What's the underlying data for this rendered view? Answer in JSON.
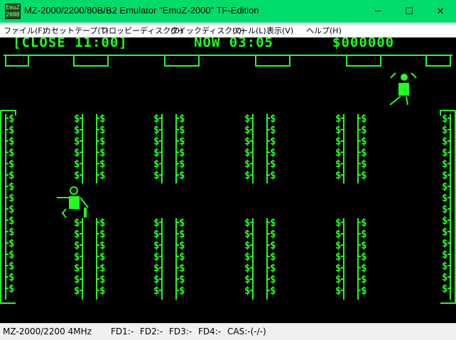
{
  "window": {
    "title": "MZ-2000/2200/80B/B2 Emulator \"EmuZ-2000\" TF-Edition",
    "icon_label_line1": "EmuZ",
    "icon_label_line2": "2000",
    "controls": {
      "minimize": "─",
      "maximize": "☐",
      "close": "✕"
    }
  },
  "menu": [
    {
      "label": "ファイル(F)"
    },
    {
      "label": "カセットテープ(T)"
    },
    {
      "label": "フロッピーディスク(D)"
    },
    {
      "label": "クイックディスク(Q)"
    },
    {
      "label": "ツール(L)"
    },
    {
      "label": "表示(V)"
    },
    {
      "label": "ヘルプ(H)"
    }
  ],
  "game": {
    "close_text": "[CLOSE 11:00]",
    "now_text": "NOW 03:05",
    "money_text": "$000000",
    "cell_symbol": "$",
    "colors": {
      "background": "#000000",
      "foreground": "#22ff22"
    }
  },
  "status": {
    "machine": "MZ-2000/2200 4MHz",
    "fd1": "FD1:-",
    "fd2": "FD2:-",
    "fd3": "FD3:-",
    "fd4": "FD4:-",
    "cas": "CAS:-(-/-)"
  }
}
